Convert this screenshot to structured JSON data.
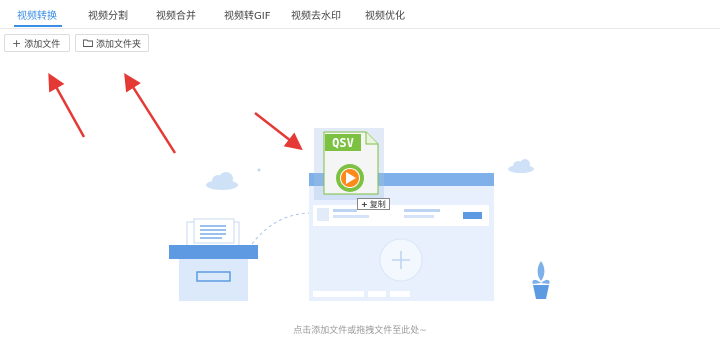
{
  "tabs": [
    {
      "label": "视频转换",
      "active": true
    },
    {
      "label": "视频分割",
      "active": false
    },
    {
      "label": "视频合并",
      "active": false
    },
    {
      "label": "视频转GIF",
      "active": false
    },
    {
      "label": "视频去水印",
      "active": false
    },
    {
      "label": "视频优化",
      "active": false
    }
  ],
  "toolbar": {
    "add_file_label": "添加文件",
    "add_folder_label": "添加文件夹",
    "add_file_icon": "plus-icon",
    "add_folder_icon": "folder-icon"
  },
  "dropzone": {
    "hint": "点击添加文件或拖拽文件至此处~",
    "drag_file_ext": "QSV",
    "drag_badge": "复制"
  },
  "colors": {
    "accent": "#3a8ee6",
    "arrow": "#e53935",
    "file_green": "#7cc142",
    "illustration_blue": "#7fb0ea",
    "illustration_light": "#e7f0fc"
  }
}
